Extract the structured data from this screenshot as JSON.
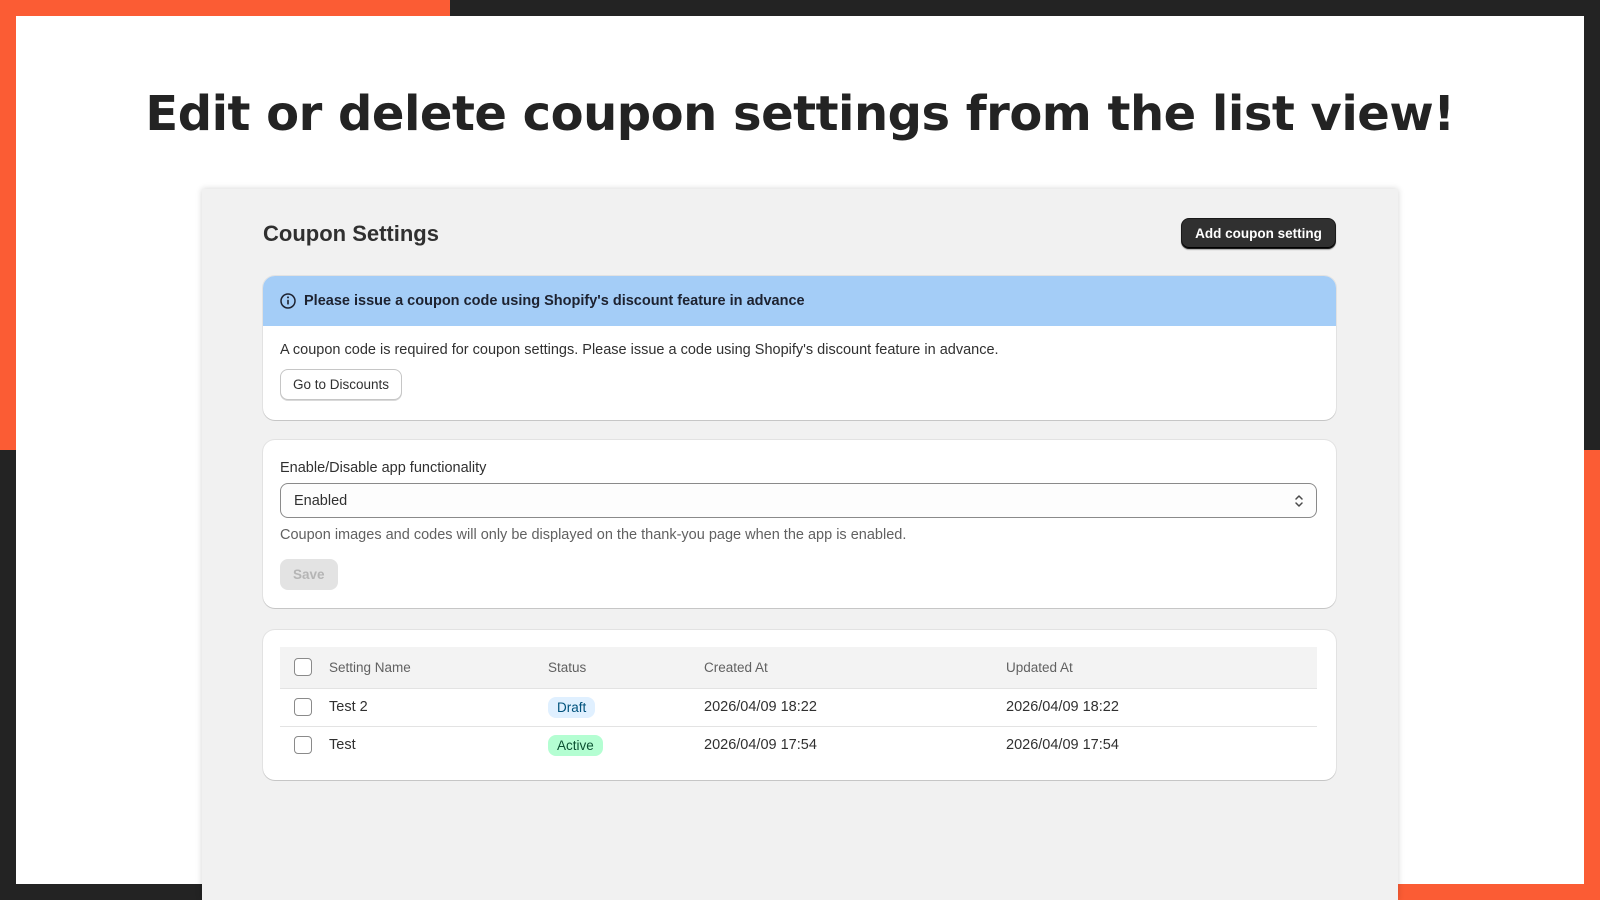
{
  "slide": {
    "headline": "Edit or delete coupon settings from the list view!"
  },
  "colors": {
    "accent_orange": "#fb5c34",
    "frame_dark": "#232323",
    "banner_blue": "#a4cdf7",
    "primary_button": "#303030"
  },
  "page": {
    "title": "Coupon Settings",
    "add_button_label": "Add coupon setting"
  },
  "banner": {
    "icon": "info-icon",
    "title": "Please issue a coupon code using Shopify's discount feature in advance",
    "body": "A coupon code is required for coupon settings. Please issue a code using Shopify's discount feature in advance.",
    "button_label": "Go to Discounts"
  },
  "functionality": {
    "label": "Enable/Disable app functionality",
    "selected_value": "Enabled",
    "help_text": "Coupon images and codes will only be displayed on the thank-you page when the app is enabled.",
    "save_label": "Save"
  },
  "table": {
    "columns": {
      "name": "Setting Name",
      "status": "Status",
      "created": "Created At",
      "updated": "Updated At"
    },
    "rows": [
      {
        "name": "Test 2",
        "status": "Draft",
        "created": "2026/04/09 18:22",
        "updated": "2026/04/09 18:22"
      },
      {
        "name": "Test",
        "status": "Active",
        "created": "2026/04/09 17:54",
        "updated": "2026/04/09 17:54"
      }
    ]
  }
}
